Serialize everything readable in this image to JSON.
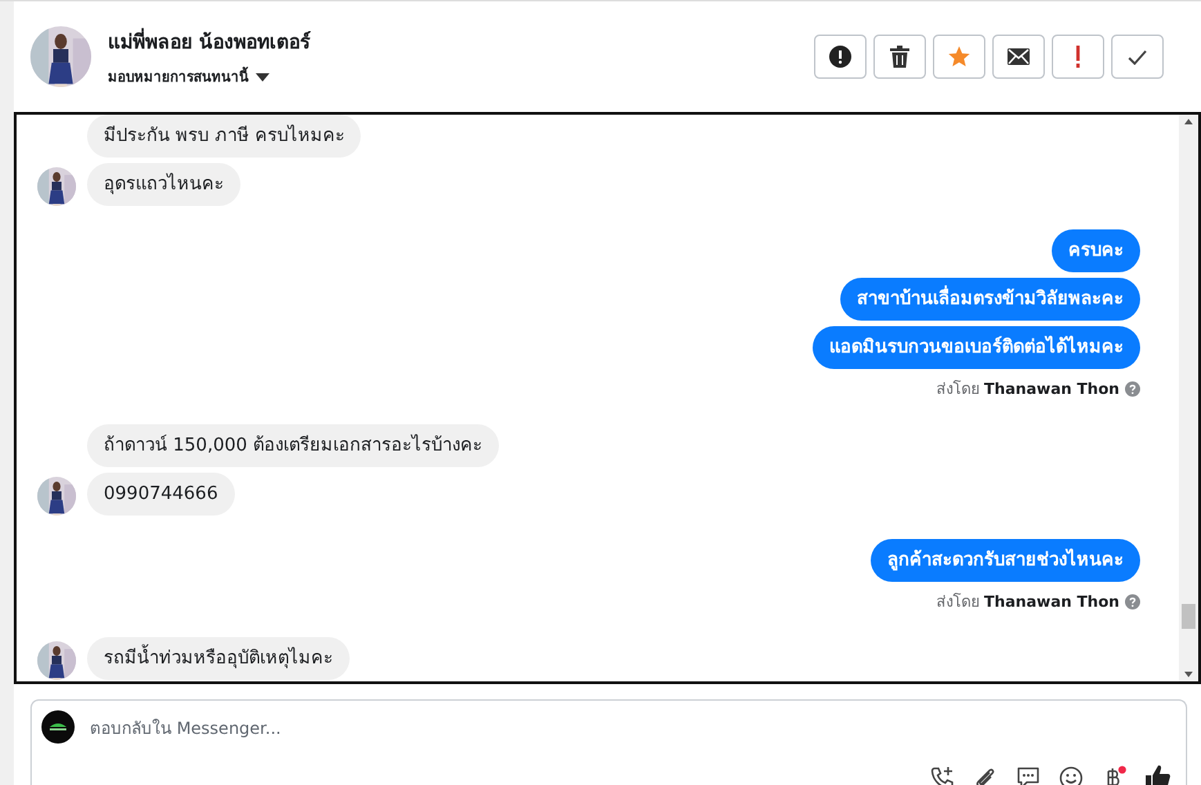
{
  "header": {
    "name": "แม่พี่พลอย น้องพอทเตอร์",
    "assign_label": "มอบหมายการสนทนานี้"
  },
  "actions": [
    {
      "kind": "alert"
    },
    {
      "kind": "trash"
    },
    {
      "kind": "star"
    },
    {
      "kind": "mail"
    },
    {
      "kind": "exclaim"
    },
    {
      "kind": "check"
    }
  ],
  "messages": [
    {
      "kind": "incoming",
      "text": "มีประกัน พรบ ภาษี ครบไหมคะ"
    },
    {
      "kind": "incoming",
      "text": "อุดรแถวไหนคะ"
    },
    {
      "kind": "outgoing",
      "text": "ครบคะ"
    },
    {
      "kind": "outgoing",
      "text": "สาขาบ้านเลื่อมตรงข้ามวิลัยพละคะ"
    },
    {
      "kind": "outgoing",
      "text": "แอดมินรบกวนขอเบอร์ติดต่อได้ไหมคะ"
    },
    {
      "kind": "note",
      "text": "ส่งโดย **Thanawan Thon**"
    },
    {
      "kind": "incoming",
      "text": "ถ้าดาวน์ 150,000 ต้องเตรียมเอกสารอะไรบ้างคะ"
    },
    {
      "kind": "incoming",
      "text": "0990744666"
    },
    {
      "kind": "outgoing",
      "text": "ลูกค้าสะดวกรับสายช่วงไหนคะ"
    },
    {
      "kind": "note",
      "text": "ส่งโดย **Thanawan Thon**"
    },
    {
      "kind": "incoming",
      "text": "รถมีน้ำท่วมหรืออุบัติเหตุไมคะ"
    }
  ],
  "composer": {
    "placeholder": "ตอบกลับใน Messenger...",
    "tools": [
      {
        "kind": "call"
      },
      {
        "kind": "clip"
      },
      {
        "kind": "chat"
      },
      {
        "kind": "emoji"
      },
      {
        "kind": "baht",
        "dot": true
      },
      {
        "kind": "like"
      }
    ]
  }
}
